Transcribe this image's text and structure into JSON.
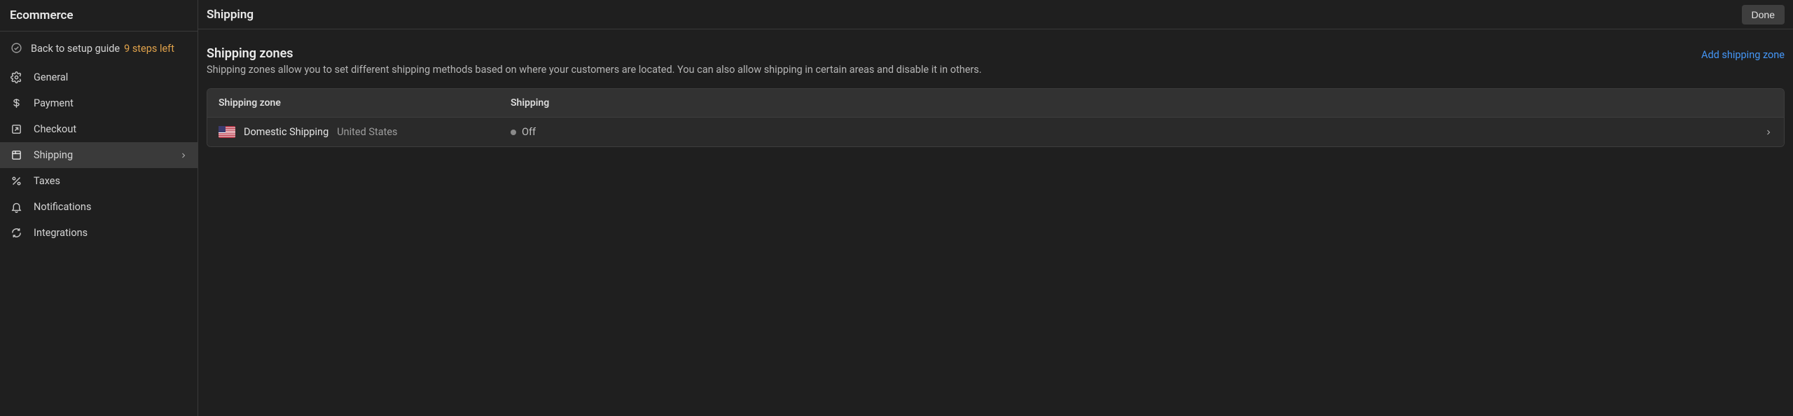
{
  "sidebar": {
    "title": "Ecommerce",
    "setup": {
      "label": "Back to setup guide",
      "steps_left": "9 steps left"
    },
    "items": [
      {
        "label": "General",
        "icon": "gear-icon",
        "active": false
      },
      {
        "label": "Payment",
        "icon": "dollar-icon",
        "active": false
      },
      {
        "label": "Checkout",
        "icon": "external-square-icon",
        "active": false
      },
      {
        "label": "Shipping",
        "icon": "package-icon",
        "active": true
      },
      {
        "label": "Taxes",
        "icon": "percent-icon",
        "active": false
      },
      {
        "label": "Notifications",
        "icon": "bell-icon",
        "active": false
      },
      {
        "label": "Integrations",
        "icon": "cycle-icon",
        "active": false
      }
    ]
  },
  "header": {
    "title": "Shipping",
    "done_label": "Done"
  },
  "section": {
    "title": "Shipping zones",
    "description": "Shipping zones allow you to set different shipping methods based on where your customers are located. You can also allow shipping in certain areas and disable it in others.",
    "add_link": "Add shipping zone"
  },
  "table": {
    "columns": {
      "zone": "Shipping zone",
      "shipping": "Shipping"
    },
    "rows": [
      {
        "name": "Domestic Shipping",
        "region": "United States",
        "shipping_status": "Off"
      }
    ]
  }
}
